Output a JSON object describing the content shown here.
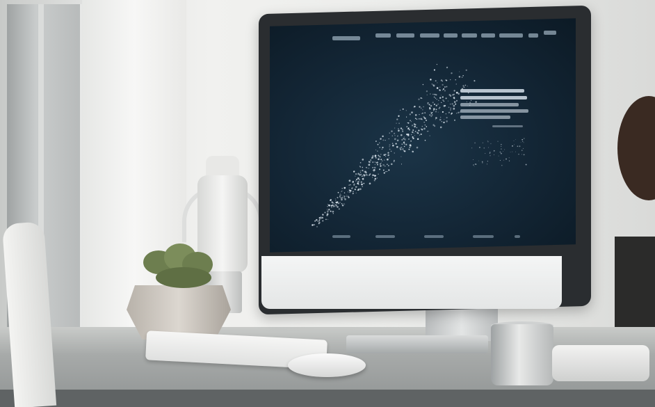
{
  "scene": {
    "objects": {
      "imac": {
        "icon": "desktop-computer-icon"
      },
      "keyboard": {
        "icon": "keyboard-icon"
      },
      "mouse": {
        "icon": "mouse-icon"
      },
      "mug": {
        "icon": "mug-icon"
      },
      "lantern": {
        "icon": "lantern-icon"
      },
      "plant": {
        "icon": "potted-plant-icon"
      }
    },
    "colors": {
      "screen_background": "#122433",
      "scatter_points": "#dfe9f2",
      "imac_frame": "#2a2d30",
      "imac_chin": "#eceeee",
      "plant_green": "#6d7e4f"
    }
  }
}
